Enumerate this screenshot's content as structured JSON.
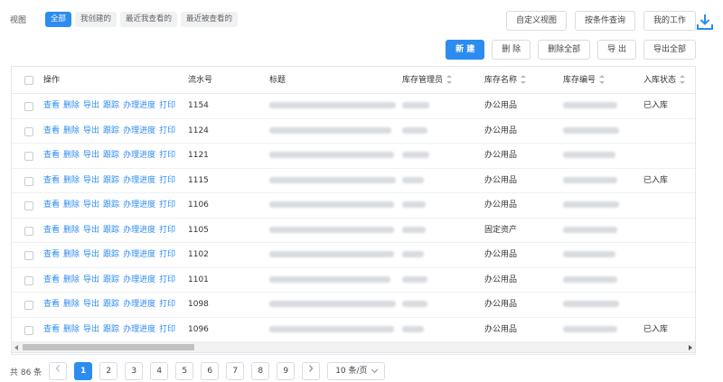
{
  "views": {
    "label": "视图",
    "tabs": [
      {
        "label": "全部",
        "active": true
      },
      {
        "label": "我创建的",
        "active": false
      },
      {
        "label": "最近我查看的",
        "active": false
      },
      {
        "label": "最近被查看的",
        "active": false
      }
    ]
  },
  "top_buttons": {
    "custom_view": "自定义视图",
    "condition_query": "按条件查询",
    "my_work": "我的工作"
  },
  "download_icon": "download-icon",
  "actions": {
    "new": "新 建",
    "delete": "删 除",
    "delete_all": "删除全部",
    "export": "导 出",
    "export_all": "导出全部"
  },
  "table": {
    "columns": {
      "ops": "操作",
      "serial": "流水号",
      "title": "标题",
      "manager": "库存管理员",
      "stock_name": "库存名称",
      "stock_code": "库存编号",
      "status": "入库状态"
    },
    "op_labels": [
      "查看",
      "删除",
      "导出",
      "跟踪",
      "办理进度",
      "打印"
    ],
    "rows": [
      {
        "serial": "1154",
        "stock_name": "办公用品",
        "status": "已入库"
      },
      {
        "serial": "1124",
        "stock_name": "办公用品",
        "status": ""
      },
      {
        "serial": "1121",
        "stock_name": "办公用品",
        "status": ""
      },
      {
        "serial": "1115",
        "stock_name": "办公用品",
        "status": "已入库"
      },
      {
        "serial": "1106",
        "stock_name": "办公用品",
        "status": ""
      },
      {
        "serial": "1105",
        "stock_name": "固定资产",
        "status": ""
      },
      {
        "serial": "1102",
        "stock_name": "办公用品",
        "status": ""
      },
      {
        "serial": "1101",
        "stock_name": "办公用品",
        "status": ""
      },
      {
        "serial": "1098",
        "stock_name": "办公用品",
        "status": ""
      },
      {
        "serial": "1096",
        "stock_name": "办公用品",
        "status": "已入库"
      }
    ]
  },
  "pagination": {
    "total": "共 86 条",
    "pages": [
      "1",
      "2",
      "3",
      "4",
      "5",
      "6",
      "7",
      "8",
      "9"
    ],
    "current": "1",
    "page_size": "10 条/页",
    "prev_icon": "chevron-left-icon",
    "next_icon": "chevron-right-icon"
  }
}
